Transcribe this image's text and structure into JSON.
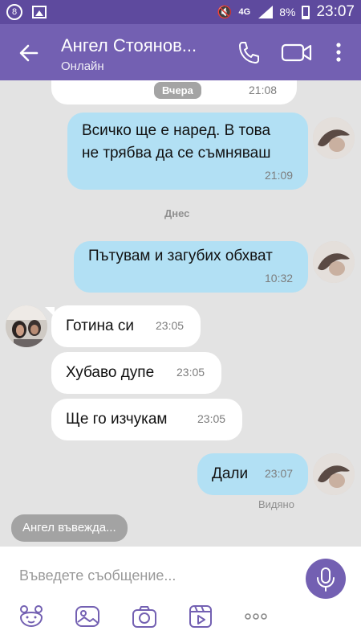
{
  "status_bar": {
    "notification_count": "8",
    "network": "4G",
    "battery": "8%",
    "time": "23:07"
  },
  "header": {
    "contact_name": "Ангел Стоянов...",
    "contact_status": "Онлайн"
  },
  "chat": {
    "date_yesterday": "Вчера",
    "date_yesterday_time": "21:08",
    "date_today": "Днес",
    "messages": [
      {
        "direction": "out",
        "lines": [
          "Всичко ще е наред. В това",
          "не трябва да се съмняваш"
        ],
        "time": "21:09"
      },
      {
        "direction": "out",
        "lines": [
          "Пътувам и загубих обхват"
        ],
        "time": "10:32"
      },
      {
        "direction": "in",
        "lines": [
          "Готина си"
        ],
        "time": "23:05"
      },
      {
        "direction": "in",
        "lines": [
          "Хубаво дупе"
        ],
        "time": "23:05"
      },
      {
        "direction": "in",
        "lines": [
          "Ще го изчукам"
        ],
        "time": "23:05"
      },
      {
        "direction": "out",
        "lines": [
          "Дали"
        ],
        "time": "23:07"
      }
    ],
    "seen_label": "Видяно",
    "typing_indicator": "Ангел въвежда..."
  },
  "composer": {
    "placeholder": "Въведете съобщение..."
  },
  "icons": {
    "back": "arrow-left-icon",
    "call": "phone-icon",
    "video": "video-camera-icon",
    "more": "more-vertical-icon",
    "mic": "microphone-icon",
    "sticker": "sticker-bear-icon",
    "gallery": "gallery-icon",
    "camera": "camera-icon",
    "gif": "gif-video-icon",
    "more_options": "more-horizontal-icon"
  },
  "colors": {
    "accent": "#7360b2",
    "status_bar": "#5e4a9e",
    "outgoing_bubble": "#b2e0f4",
    "incoming_bubble": "#ffffff",
    "chat_background": "#e3e3e3"
  }
}
